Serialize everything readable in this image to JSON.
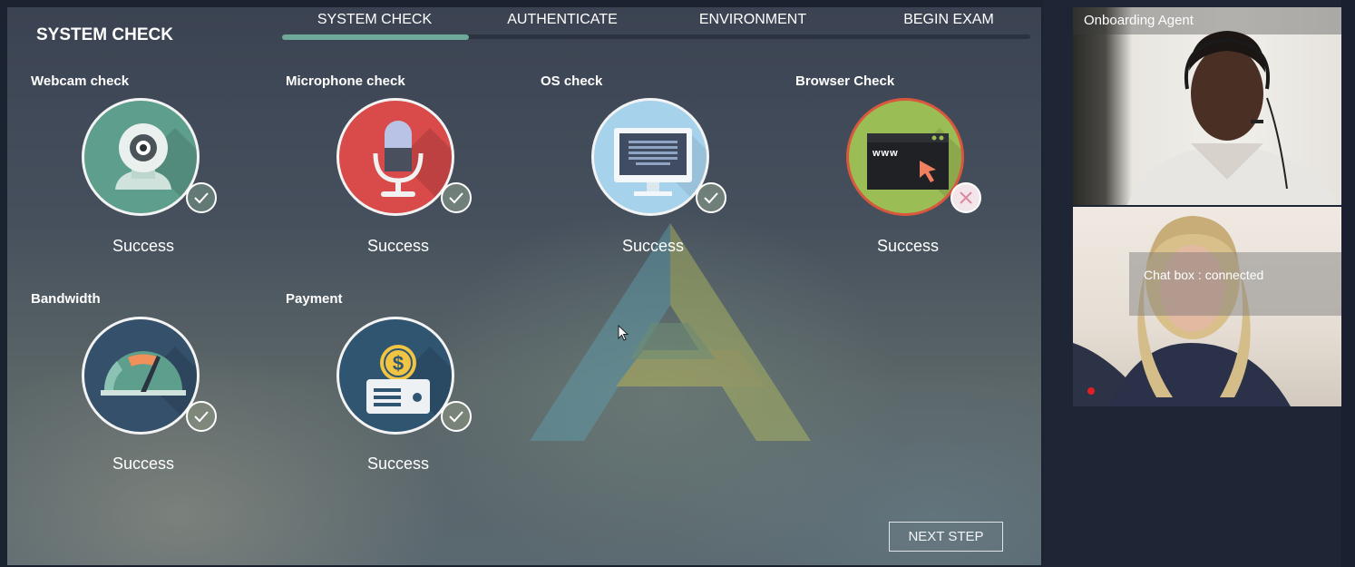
{
  "page_title": "SYSTEM CHECK",
  "tabs": [
    {
      "label": "SYSTEM CHECK",
      "active": true
    },
    {
      "label": "AUTHENTICATE",
      "active": false
    },
    {
      "label": "ENVIRONMENT",
      "active": false
    },
    {
      "label": "BEGIN EXAM",
      "active": false
    }
  ],
  "checks": [
    {
      "label": "Webcam check",
      "status": "Success",
      "icon": "webcam-icon",
      "result": "pass",
      "color": "#5e9e8d"
    },
    {
      "label": "Microphone check",
      "status": "Success",
      "icon": "microphone-icon",
      "result": "pass",
      "color": "#d94a4a"
    },
    {
      "label": "OS check",
      "status": "Success",
      "icon": "monitor-icon",
      "result": "pass",
      "color": "#a6d2ec"
    },
    {
      "label": "Browser Check",
      "status": "Success",
      "icon": "browser-icon",
      "result": "fail",
      "color": "#9bbd55"
    },
    {
      "label": "Bandwidth",
      "status": "Success",
      "icon": "speedometer-icon",
      "result": "pass",
      "color": "#34506a"
    },
    {
      "label": "Payment",
      "status": "Success",
      "icon": "payment-card-icon",
      "result": "pass",
      "color": "#2f5570"
    }
  ],
  "browser_icon_text": "www",
  "next_button": "NEXT STEP",
  "agent_video": {
    "label": "Onboarding Agent"
  },
  "chat": {
    "status": "Chat box : connected"
  },
  "colors": {
    "accent": "#6fa99a",
    "fail": "#e0a0b0",
    "pass": "#6fa99a"
  }
}
